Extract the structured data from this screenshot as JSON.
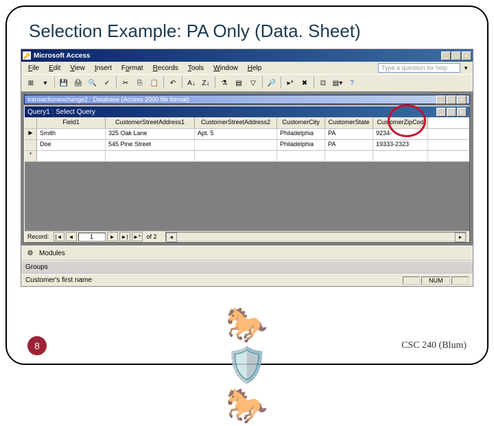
{
  "slide": {
    "title": "Selection Example: PA Only (Data. Sheet)",
    "page_number": "8",
    "course": "CSC 240 (Blum)"
  },
  "app": {
    "title": "Microsoft Access",
    "menus": [
      "File",
      "Edit",
      "View",
      "Insert",
      "Format",
      "Records",
      "Tools",
      "Window",
      "Help"
    ],
    "help_placeholder": "Type a question for help",
    "db_window_title": "transactionexchange2 : Database (Access 2000 file format)",
    "query_window_title": "Query1 : Select Query"
  },
  "datasheet": {
    "columns": [
      "Field1",
      "CustomerStreetAddress1",
      "CustomerStreetAddress2",
      "CustomerCity",
      "CustomerState",
      "CustomerZipCod"
    ],
    "rows": [
      {
        "sel": "▶",
        "field1": "Smith",
        "addr1": "325 Oak Lane",
        "addr2": "Apt. 5",
        "city": "Philadelphia",
        "state": "PA",
        "zip": "9234-"
      },
      {
        "sel": "",
        "field1": "Doe",
        "addr1": "545 Pine Street",
        "addr2": "",
        "city": "Philadelphia",
        "state": "PA",
        "zip": "19333-2323"
      },
      {
        "sel": "*",
        "field1": "",
        "addr1": "",
        "addr2": "",
        "city": "",
        "state": "",
        "zip": ""
      }
    ]
  },
  "nav": {
    "label": "Record:",
    "current": "1",
    "of_text": "of  2"
  },
  "sidebar": {
    "modules_label": "Modules",
    "groups_label": "Groups"
  },
  "statusbar": {
    "text": "Customer's first name",
    "num": "NUM"
  },
  "colors": {
    "accent": "#0a246a",
    "panel": "#ece9d8",
    "circle": "#c8102e"
  }
}
